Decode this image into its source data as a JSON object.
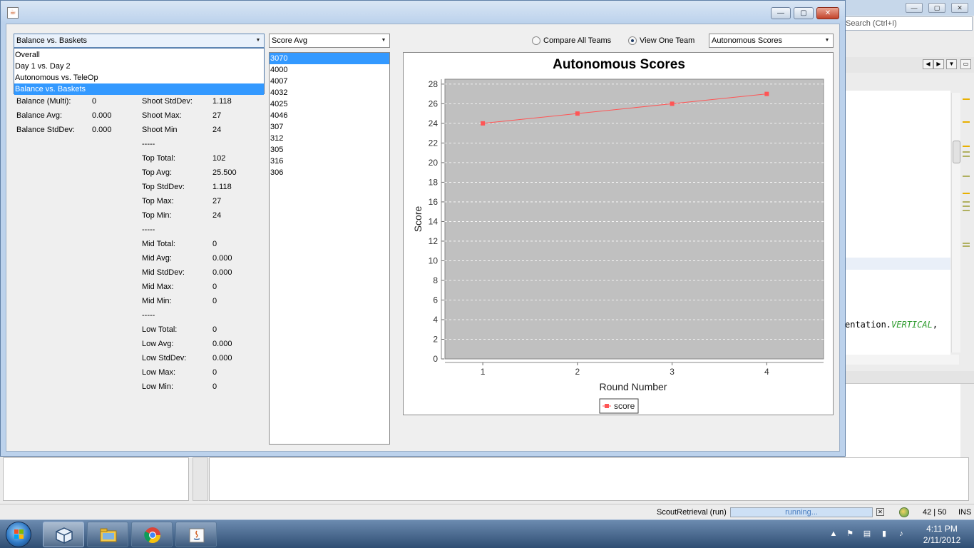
{
  "ide": {
    "search_placeholder": "Search (Ctrl+I)",
    "code_prefix": "entation.",
    "code_keyword": "VERTICAL",
    "code_suffix": ",",
    "status": {
      "task_label": "ScoutRetrieval (run)",
      "progress_text": "running...",
      "position": "42 | 50",
      "mode": "INS"
    }
  },
  "window": {
    "buttons": {
      "minimize": "—",
      "maximize": "▢",
      "close": "✕"
    }
  },
  "view_combo": {
    "selected": "Balance vs. Baskets",
    "options": [
      "Overall",
      "Day 1 vs. Day 2",
      "Autonomous vs. TeleOp",
      "Balance vs. Baskets"
    ],
    "selected_index": 3
  },
  "sort_combo": {
    "selected": "Score Avg"
  },
  "stats_left": [
    {
      "label": "Balance (Multi):",
      "value": "0"
    },
    {
      "label": "Balance Avg:",
      "value": "0.000"
    },
    {
      "label": "Balance StdDev:",
      "value": "0.000"
    }
  ],
  "stats_right": [
    {
      "label": "Shoot StdDev:",
      "value": "1.118"
    },
    {
      "label": "Shoot Max:",
      "value": "27"
    },
    {
      "label": "Shoot Min",
      "value": "24"
    },
    {
      "label": "-----",
      "value": ""
    },
    {
      "label": "Top Total:",
      "value": "102"
    },
    {
      "label": "Top Avg:",
      "value": "25.500"
    },
    {
      "label": "Top StdDev:",
      "value": "1.118"
    },
    {
      "label": "Top Max:",
      "value": "27"
    },
    {
      "label": "Top Min:",
      "value": "24"
    },
    {
      "label": "-----",
      "value": ""
    },
    {
      "label": "Mid Total:",
      "value": "0"
    },
    {
      "label": "Mid Avg:",
      "value": "0.000"
    },
    {
      "label": "Mid StdDev:",
      "value": "0.000"
    },
    {
      "label": "Mid Max:",
      "value": "0"
    },
    {
      "label": "Mid Min:",
      "value": "0"
    },
    {
      "label": "-----",
      "value": ""
    },
    {
      "label": "Low Total:",
      "value": "0"
    },
    {
      "label": "Low Avg:",
      "value": "0.000"
    },
    {
      "label": "Low StdDev:",
      "value": "0.000"
    },
    {
      "label": "Low Max:",
      "value": "0"
    },
    {
      "label": "Low Min:",
      "value": "0"
    }
  ],
  "teams": {
    "items": [
      "3070",
      "4000",
      "4007",
      "4032",
      "4025",
      "4046",
      "307",
      "312",
      "305",
      "316",
      "306"
    ],
    "selected_index": 0
  },
  "mode": {
    "compare_label": "Compare All Teams",
    "view_one_label": "View One Team",
    "selected": "View One Team"
  },
  "chart_combo": {
    "selected": "Autonomous Scores"
  },
  "chart_data": {
    "type": "line",
    "title": "Autonomous Scores",
    "xlabel": "Round Number",
    "ylabel": "Score",
    "x": [
      1,
      2,
      3,
      4
    ],
    "series": [
      {
        "name": "score",
        "values": [
          24,
          25,
          26,
          27
        ],
        "color": "#ff5555"
      }
    ],
    "xlim": [
      0.6,
      4.6
    ],
    "ylim": [
      0,
      28.5
    ],
    "yticks": [
      0,
      2,
      4,
      6,
      8,
      10,
      12,
      14,
      16,
      18,
      20,
      22,
      24,
      26,
      28
    ],
    "xticks": [
      1,
      2,
      3,
      4
    ],
    "plot_background": "#c0c0c0",
    "grid": true,
    "legend_position": "bottom"
  },
  "taskbar": {
    "time": "4:11 PM",
    "date": "2/11/2012"
  }
}
